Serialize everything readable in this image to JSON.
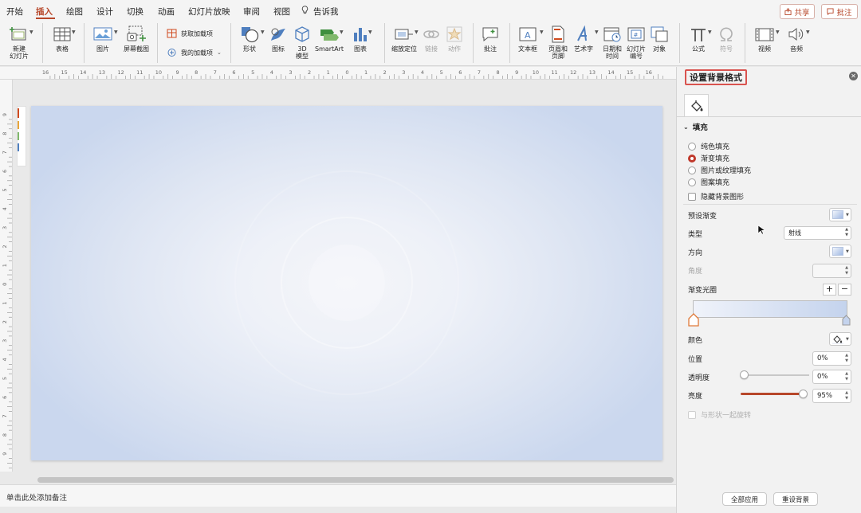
{
  "menu": {
    "tabs": [
      {
        "label": "开始"
      },
      {
        "label": "插入",
        "active": true
      },
      {
        "label": "绘图"
      },
      {
        "label": "设计"
      },
      {
        "label": "切换"
      },
      {
        "label": "动画"
      },
      {
        "label": "幻灯片放映"
      },
      {
        "label": "审阅"
      },
      {
        "label": "视图"
      },
      {
        "label": "告诉我"
      }
    ],
    "share_label": "共享",
    "comment_label": "批注"
  },
  "ribbon": {
    "new_slide": "新建\n幻灯片",
    "table": "表格",
    "picture": "图片",
    "screenshot": "屏幕截图",
    "get_addins": "获取加载项",
    "my_addins": "我的加载项",
    "shapes": "形状",
    "icons": "图标",
    "model_3d": "3D\n模型",
    "smartart": "SmartArt",
    "chart": "图表",
    "zoom": "缩放定位",
    "link": "链接",
    "action": "动作",
    "comment": "批注",
    "textbox": "文本框",
    "header_footer": "页眉和\n页脚",
    "wordart": "艺术字",
    "datetime": "日期和\n时间",
    "slide_number": "幻灯片\n编号",
    "object": "对象",
    "equation": "公式",
    "symbol": "符号",
    "video": "视频",
    "audio": "音频"
  },
  "ruler": {
    "h_numbers": [
      "16",
      "15",
      "14",
      "13",
      "12",
      "11",
      "10",
      "9",
      "8",
      "7",
      "6",
      "5",
      "4",
      "3",
      "2",
      "1",
      "0",
      "1",
      "2",
      "3",
      "4",
      "5",
      "6",
      "7",
      "8",
      "9",
      "10",
      "11",
      "12",
      "13",
      "14",
      "15",
      "16"
    ],
    "v_numbers": [
      "9",
      "8",
      "7",
      "6",
      "5",
      "4",
      "3",
      "2",
      "1",
      "0",
      "1",
      "2",
      "3",
      "4",
      "5",
      "6",
      "7",
      "8",
      "9"
    ]
  },
  "notes": {
    "placeholder": "单击此处添加备注"
  },
  "pane": {
    "title": "设置背景格式",
    "section_fill": "填充",
    "fill_options": [
      {
        "label": "纯色填充",
        "checked": false
      },
      {
        "label": "渐变填充",
        "checked": true
      },
      {
        "label": "图片或纹理填充",
        "checked": false
      },
      {
        "label": "图案填充",
        "checked": false
      }
    ],
    "hide_bg": "隐藏背景图形",
    "preset_gradient": "预设渐变",
    "type_label": "类型",
    "type_value": "射线",
    "direction_label": "方向",
    "angle_label": "角度",
    "angle_value": "",
    "gradient_stops": "渐变光圈",
    "color_label": "颜色",
    "position_label": "位置",
    "position_value": "0%",
    "transparency_label": "透明度",
    "transparency_value": "0%",
    "transparency": 0,
    "brightness_label": "亮度",
    "brightness_value": "95%",
    "brightness": 0.95,
    "rotate_with_shape": "与形状一起旋转",
    "apply_all": "全部应用",
    "reset_bg": "重设背景"
  },
  "colors": {
    "accent": "#b7472a",
    "highlight_border": "#d9534f",
    "gradient_start": "#f0f3fa",
    "gradient_end": "#c4d3ed"
  }
}
